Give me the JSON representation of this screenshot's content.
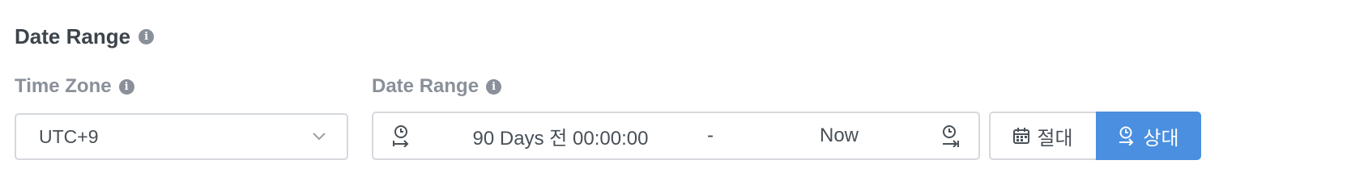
{
  "section": {
    "title": "Date Range"
  },
  "time_zone": {
    "label": "Time Zone",
    "value": "UTC+9"
  },
  "date_range": {
    "label": "Date Range",
    "start": "90 Days 전 00:00:00",
    "separator": "-",
    "end": "Now"
  },
  "mode": {
    "absolute_label": "절대",
    "relative_label": "상대",
    "selected": "relative"
  },
  "icons": {
    "info": "info-circle-icon",
    "chevron": "chevron-down-icon",
    "start": "clock-arrow-start-icon",
    "end": "clock-arrow-end-icon",
    "calendar": "calendar-icon"
  },
  "colors": {
    "accent": "#4a8fe0",
    "label": "#8a9099",
    "border": "#d5d8dc"
  }
}
